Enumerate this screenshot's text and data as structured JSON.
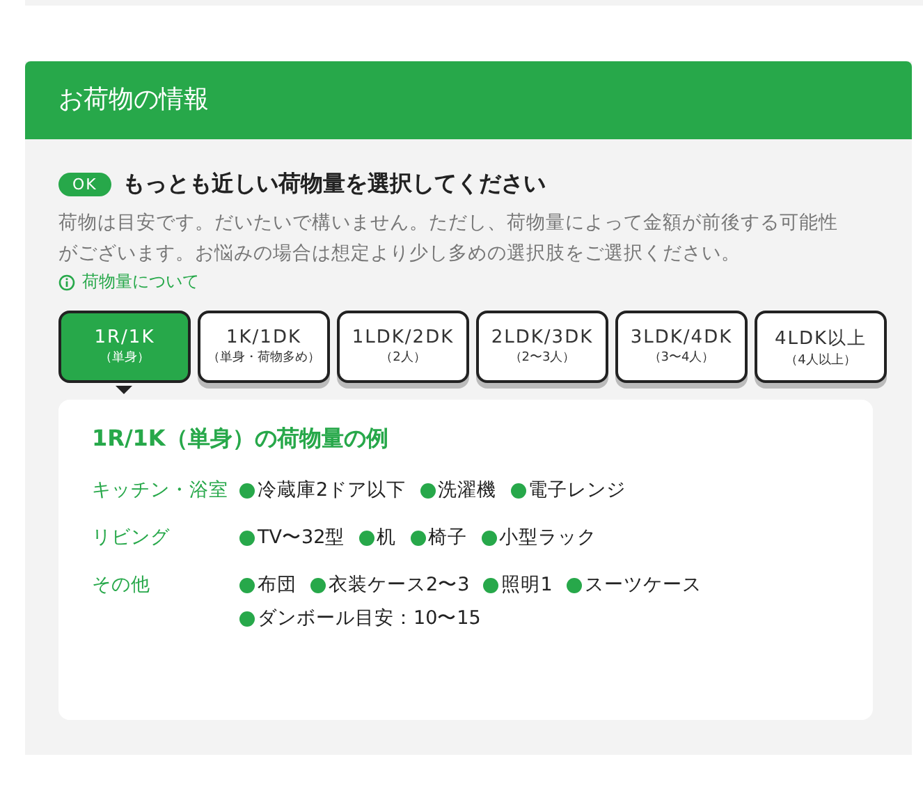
{
  "section": {
    "title": "お荷物の情報"
  },
  "prompt": {
    "badge": "OK",
    "heading": "もっとも近しい荷物量を選択してください",
    "description": "荷物は目安です。だいたいで構いません。ただし、荷物量によって金額が前後する可能性がございます。お悩みの場合は想定より少し多めの選択肢をご選択ください。",
    "help_link": "荷物量について"
  },
  "options": [
    {
      "main": "1R/1K",
      "sub": "（単身）",
      "selected": true
    },
    {
      "main": "1K/1DK",
      "sub": "（単身・荷物多め）",
      "selected": false
    },
    {
      "main": "1LDK/2DK",
      "sub": "（2人）",
      "selected": false
    },
    {
      "main": "2LDK/3DK",
      "sub": "（2〜3人）",
      "selected": false
    },
    {
      "main": "3LDK/4DK",
      "sub": "（3〜4人）",
      "selected": false
    },
    {
      "main": "4LDK以上",
      "sub": "（4人以上）",
      "selected": false
    }
  ],
  "example": {
    "title": "1R/1K（単身）の荷物量の例",
    "groups": [
      {
        "label": "キッチン・浴室",
        "items": [
          "冷蔵庫2ドア以下",
          "洗濯機",
          "電子レンジ"
        ]
      },
      {
        "label": "リビング",
        "items": [
          "TV〜32型",
          "机",
          "椅子",
          "小型ラック"
        ]
      },
      {
        "label": "その他",
        "items": [
          "布団",
          "衣装ケース2〜3",
          "照明1",
          "スーツケース",
          "ダンボール目安：10〜15"
        ]
      }
    ]
  }
}
